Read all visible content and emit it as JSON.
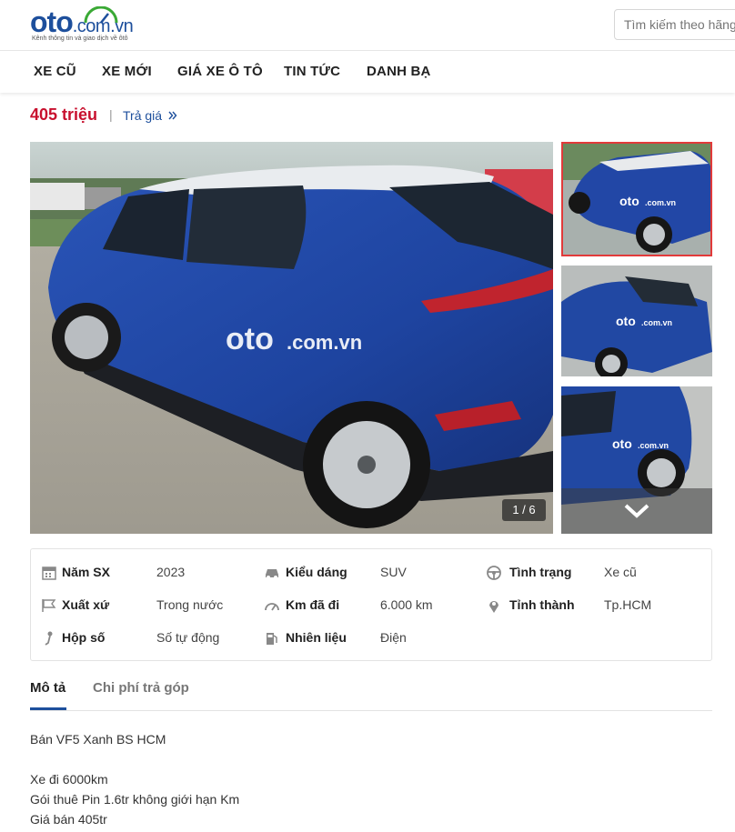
{
  "header": {
    "logo_main": "oto",
    "logo_suffix": ".com.vn",
    "logo_tagline": "Kênh thông tin và giao dịch về ôtô",
    "search_placeholder": "Tìm kiếm theo hãng"
  },
  "nav": {
    "items": [
      {
        "label": "XE CŨ"
      },
      {
        "label": "XE MỚI"
      },
      {
        "label": "GIÁ XE Ô TÔ"
      },
      {
        "label": "TIN TỨC"
      },
      {
        "label": "DANH BẠ"
      }
    ]
  },
  "listing": {
    "price": "405 triệu",
    "separator": "|",
    "offer_label": "Trả giá",
    "offer_icon": "double-chevron-right-icon",
    "accent_color": "#c8102e",
    "brand_color": "#1d4f9c"
  },
  "gallery": {
    "counter": "1 / 6",
    "watermark": "oto.com.vn",
    "thumbnails": [
      "thumb-1",
      "thumb-2",
      "thumb-3"
    ],
    "more_icon": "chevron-down-icon"
  },
  "specs": {
    "items": [
      {
        "icon": "calendar-icon",
        "label": "Năm SX",
        "value": "2023"
      },
      {
        "icon": "car-icon",
        "label": "Kiểu dáng",
        "value": "SUV"
      },
      {
        "icon": "steering-wheel-icon",
        "label": "Tình trạng",
        "value": "Xe cũ"
      },
      {
        "icon": "flag-icon",
        "label": "Xuất xứ",
        "value": "Trong nước"
      },
      {
        "icon": "speedometer-icon",
        "label": "Km đã đi",
        "value": "6.000 km"
      },
      {
        "icon": "location-pin-icon",
        "label": "Tỉnh thành",
        "value": "Tp.HCM"
      },
      {
        "icon": "gear-stick-icon",
        "label": "Hộp số",
        "value": "Số tự động"
      },
      {
        "icon": "fuel-pump-icon",
        "label": "Nhiên liệu",
        "value": "Điện"
      }
    ]
  },
  "tabs": {
    "description": "Mô tả",
    "installment": "Chi phí trả góp"
  },
  "description": {
    "lines": [
      "Bán VF5 Xanh BS HCM",
      "Xe đi 6000km",
      "Gói thuê Pin 1.6tr không giới hạn Km",
      "Giá bán 405tr"
    ]
  }
}
